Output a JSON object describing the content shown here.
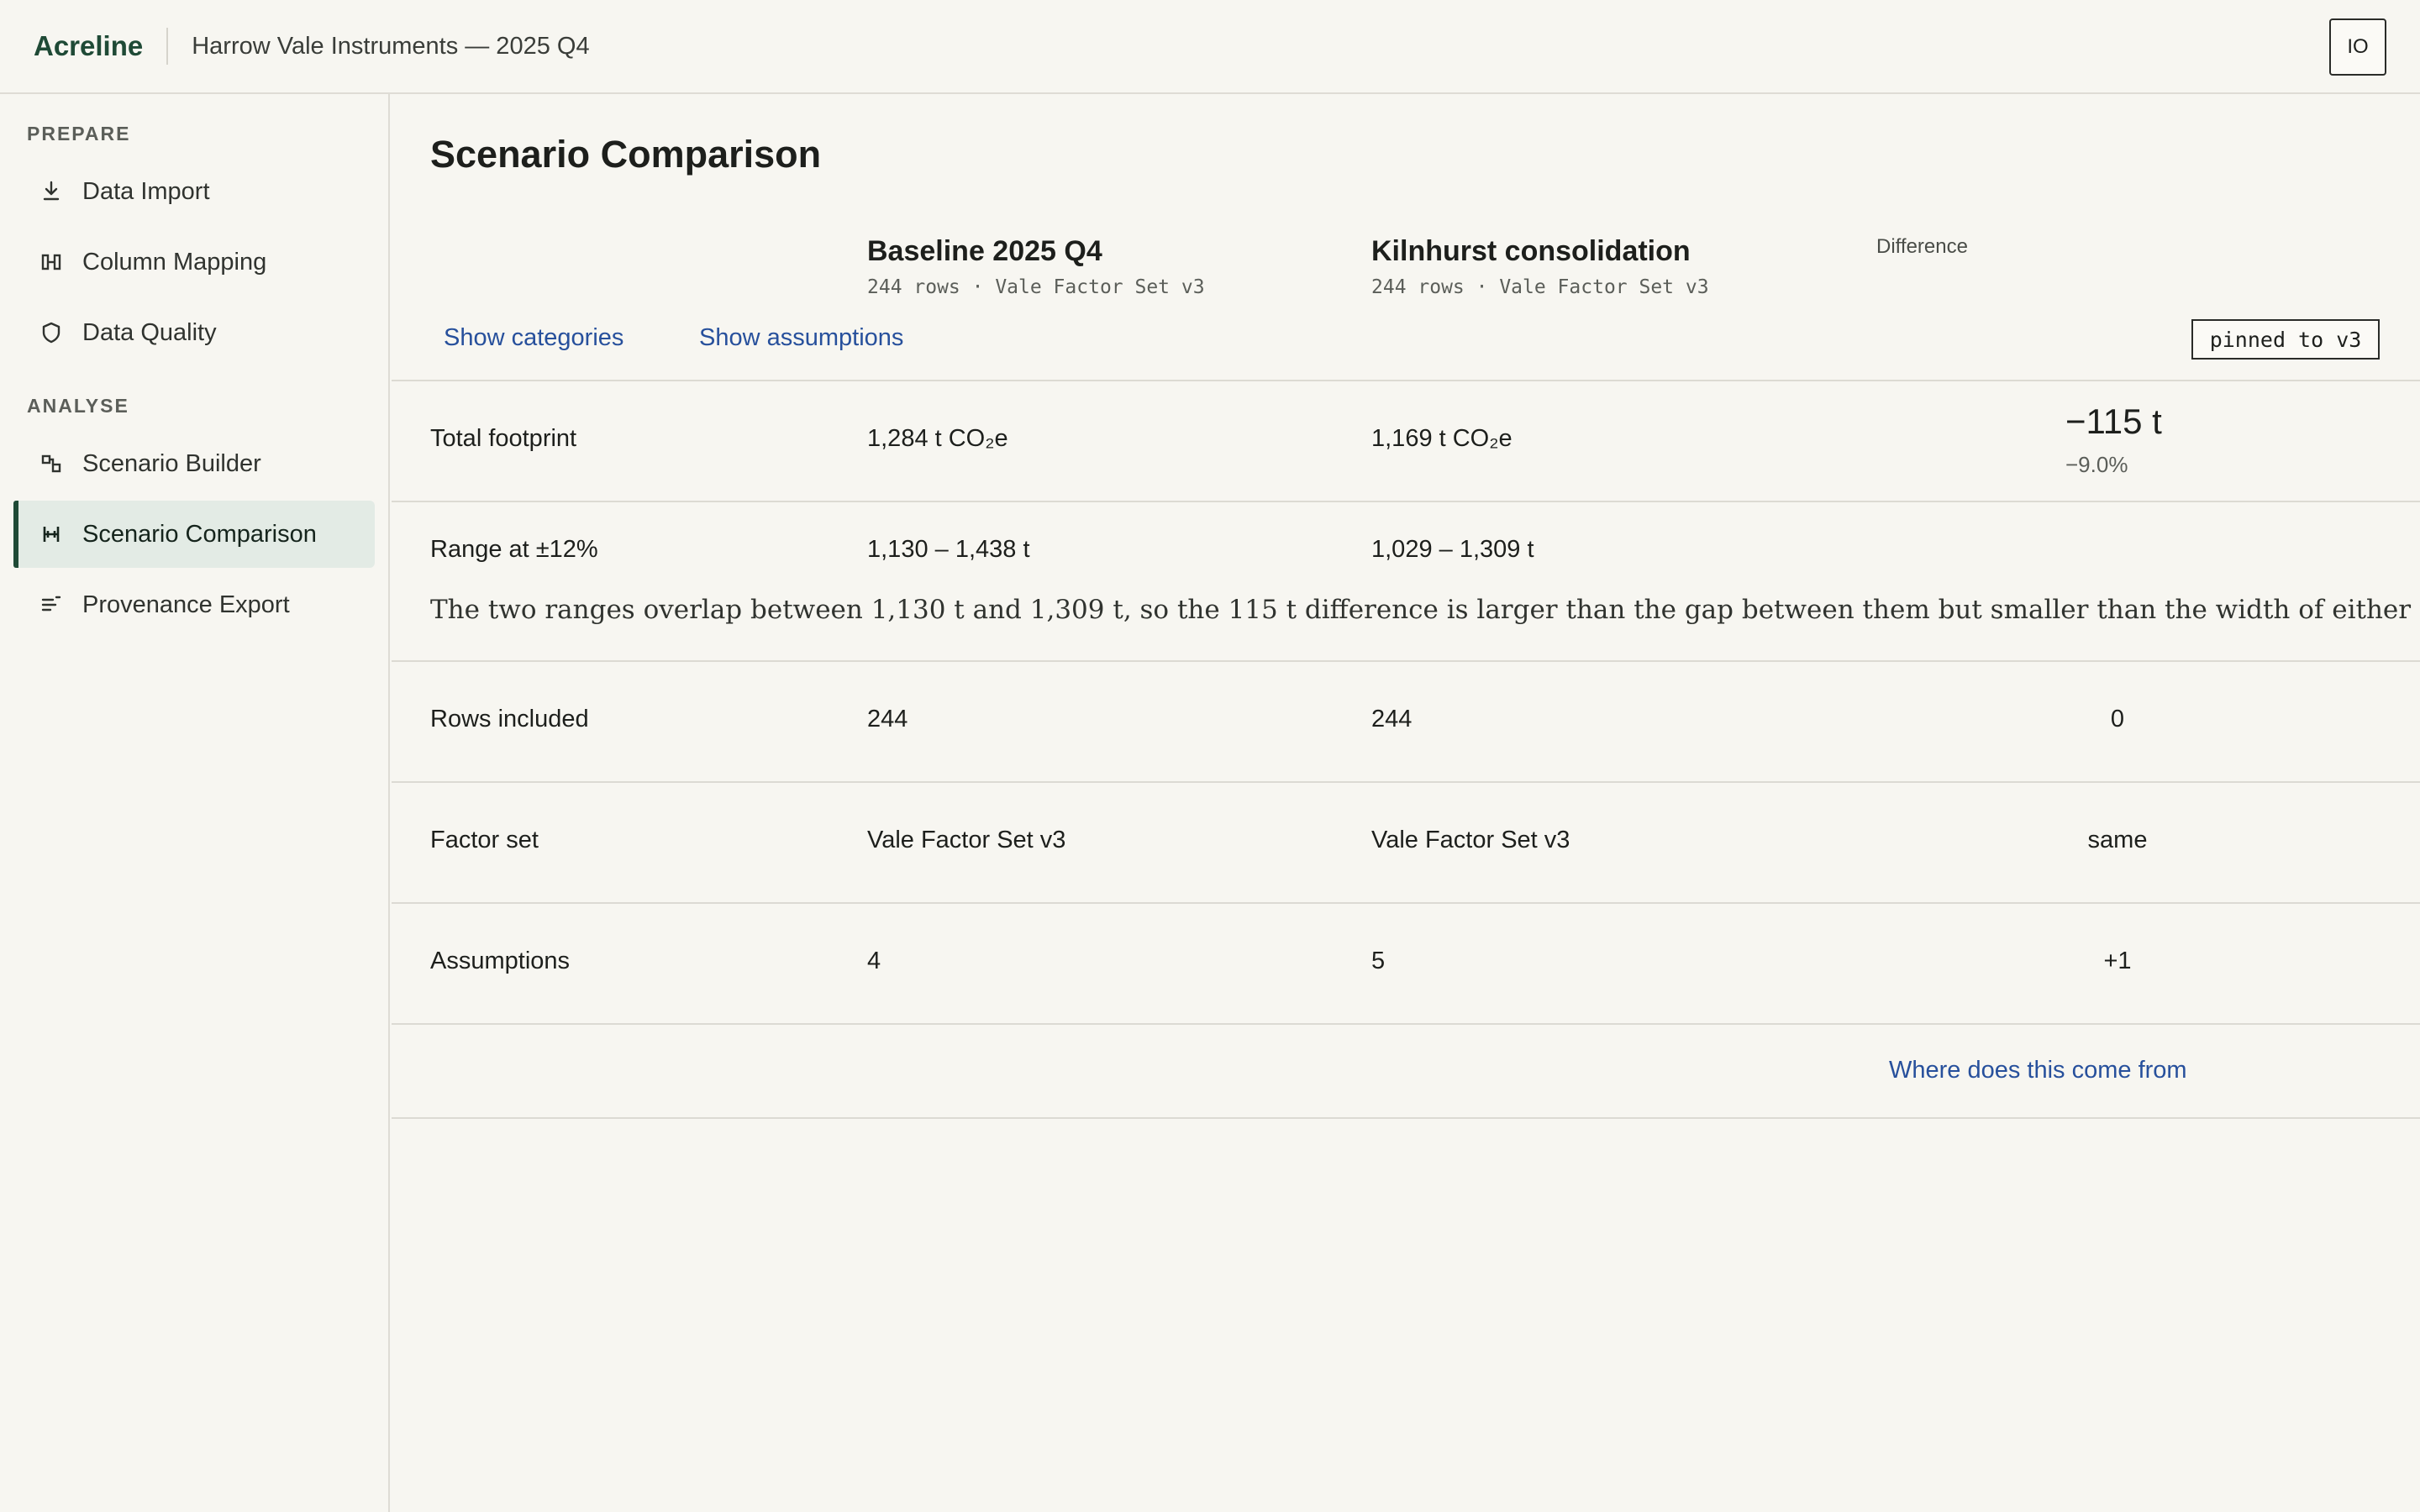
{
  "header": {
    "brand": "Acreline",
    "project": "Harrow Vale Instruments — 2025 Q4",
    "avatar_initials": "IO"
  },
  "sidebar": {
    "sections": [
      {
        "label": "PREPARE",
        "items": [
          {
            "label": "Data Import",
            "icon": "download-icon"
          },
          {
            "label": "Column Mapping",
            "icon": "column-mapping-icon"
          },
          {
            "label": "Data Quality",
            "icon": "shield-icon"
          }
        ]
      },
      {
        "label": "ANALYSE",
        "items": [
          {
            "label": "Scenario Builder",
            "icon": "scenario-builder-icon"
          },
          {
            "label": "Scenario Comparison",
            "icon": "compare-icon",
            "active": true
          },
          {
            "label": "Provenance Export",
            "icon": "export-list-icon"
          }
        ]
      }
    ]
  },
  "main": {
    "title": "Scenario Comparison",
    "columns": {
      "a": {
        "title": "Baseline 2025 Q4",
        "subtitle": "244 rows · Vale Factor Set v3"
      },
      "b": {
        "title": "Kilnhurst consolidation",
        "subtitle": "244 rows · Vale Factor Set v3"
      },
      "diff": {
        "title": "Difference"
      }
    },
    "toggles": {
      "categories": "Show categories",
      "assumptions": "Show assumptions"
    },
    "pinned": "pinned to v3",
    "rows": {
      "total": {
        "label": "Total footprint",
        "a": "1,284 t CO₂e",
        "b": "1,169 t CO₂e",
        "diff": "−115 t",
        "diff_pct": "−9.0%"
      },
      "range": {
        "label": "Range at ±12%",
        "a": "1,130 – 1,438 t",
        "b": "1,029 – 1,309 t",
        "note": "The two ranges overlap between 1,130 t and 1,309 t, so the 115 t difference is larger than the gap between them but smaller than the width of either range."
      },
      "rows_included": {
        "label": "Rows included",
        "a": "244",
        "b": "244",
        "diff": "0"
      },
      "factor_set": {
        "label": "Factor set",
        "a": "Vale Factor Set v3",
        "b": "Vale Factor Set v3",
        "diff": "same"
      },
      "assumptions": {
        "label": "Assumptions",
        "a": "4",
        "b": "5",
        "diff": "+1"
      }
    },
    "provenance_link": "Where does this come from"
  },
  "colors": {
    "brand": "#1f4a36",
    "link": "#27509c",
    "active_bg": "#e3ebe5",
    "background": "#f7f6f1"
  }
}
